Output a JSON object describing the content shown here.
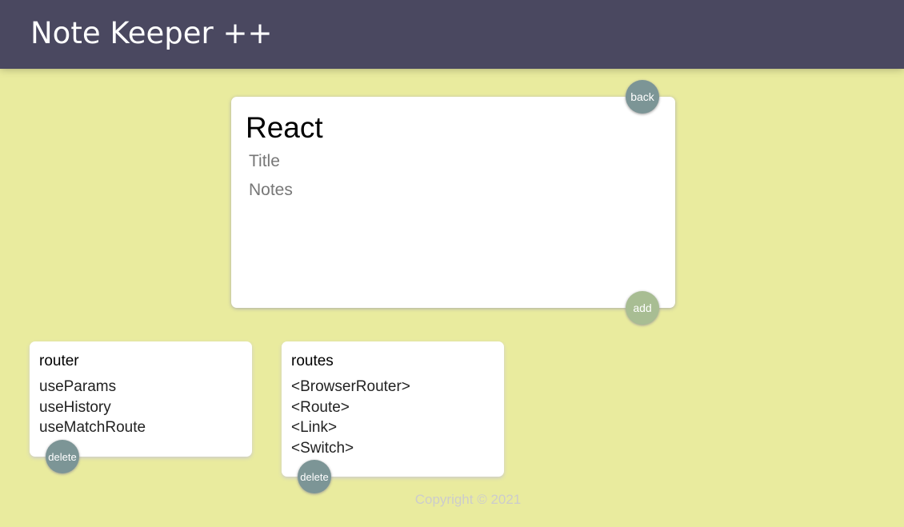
{
  "header": {
    "title": "Note Keeper ++"
  },
  "editor": {
    "heading": "React",
    "title_placeholder": "Title",
    "notes_placeholder": "Notes",
    "back_label": "back",
    "add_label": "add"
  },
  "notes": [
    {
      "title": "router",
      "lines": [
        "useParams",
        "useHistory",
        "useMatchRoute"
      ],
      "delete_label": "delete"
    },
    {
      "title": "routes",
      "lines": [
        "<BrowserRouter>",
        "<Route>",
        "<Link>",
        "<Switch>"
      ],
      "delete_label": "delete"
    }
  ],
  "footer": {
    "text": "Copyright © 2021"
  },
  "colors": {
    "header_bg": "#4a4860",
    "page_bg": "#e9eb9e",
    "button_teal": "#7c9596",
    "button_green": "#a8bd93",
    "footer_text": "#cccccc"
  }
}
